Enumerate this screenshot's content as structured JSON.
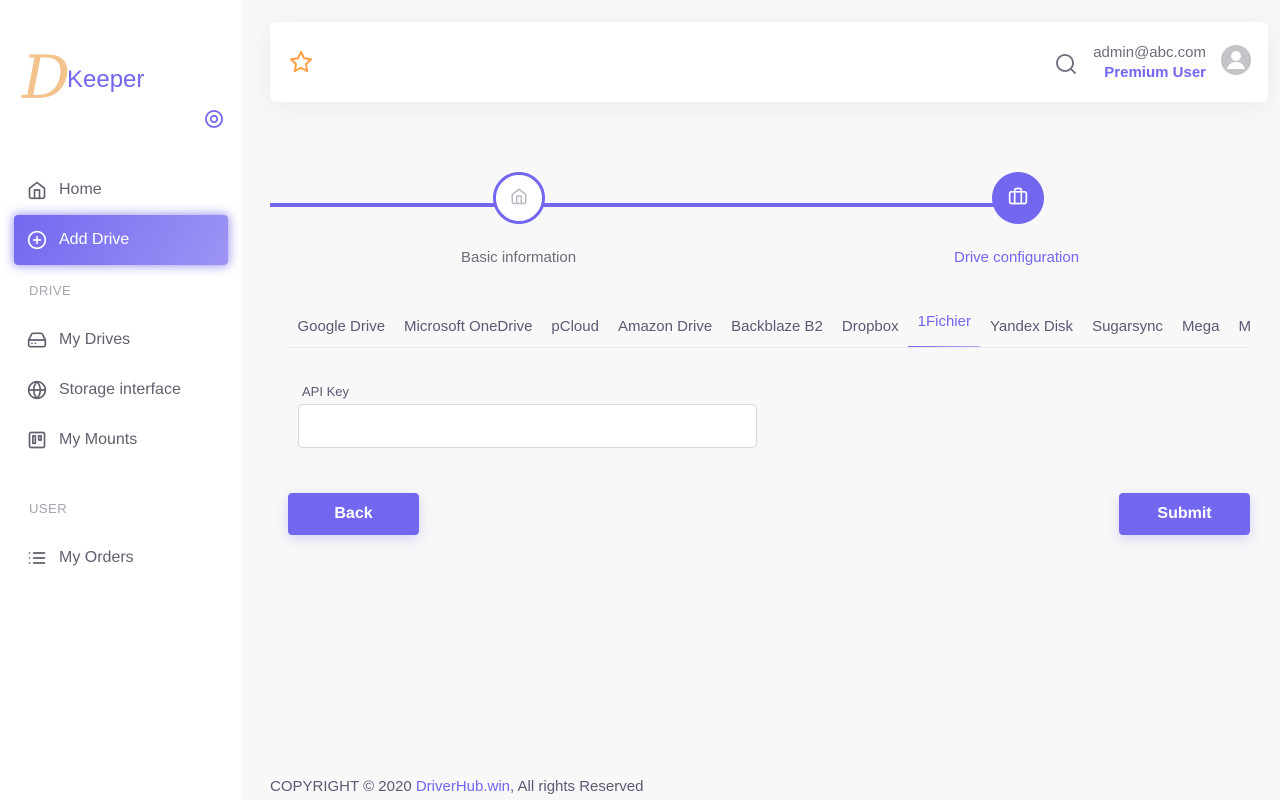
{
  "brand": {
    "logo_letter": "D",
    "name": "Keeper"
  },
  "sidebar": {
    "items": [
      {
        "label": "Home",
        "icon": "home-icon"
      },
      {
        "label": "Add Drive",
        "icon": "plus-circle-icon",
        "active": true
      }
    ],
    "drive_header": "DRIVE",
    "drive_items": [
      {
        "label": "My Drives",
        "icon": "hard-drive-icon"
      },
      {
        "label": "Storage interface",
        "icon": "globe-icon"
      },
      {
        "label": "My Mounts",
        "icon": "trello-icon"
      }
    ],
    "user_header": "USER",
    "user_items": [
      {
        "label": "My Orders",
        "icon": "list-icon"
      }
    ]
  },
  "navbar": {
    "email": "admin@abc.com",
    "role": "Premium User"
  },
  "stepper": {
    "steps": [
      {
        "label": "Basic information",
        "icon": "home-icon"
      },
      {
        "label": "Drive configuration",
        "icon": "briefcase-icon",
        "active": true
      }
    ]
  },
  "tabs": [
    "Google Drive",
    "Microsoft OneDrive",
    "pCloud",
    "Amazon Drive",
    "Backblaze B2",
    "Dropbox",
    "1Fichier",
    "Yandex Disk",
    "Sugarsync",
    "Mega",
    "Mail."
  ],
  "active_tab": "1Fichier",
  "form": {
    "api_key_label": "API Key",
    "api_key_value": ""
  },
  "buttons": {
    "back": "Back",
    "submit": "Submit"
  },
  "footer": {
    "prefix": "COPYRIGHT © 2020 ",
    "link": "DriverHub.win",
    "suffix": ", All rights Reserved"
  },
  "colors": {
    "accent": "#7367f0",
    "logo": "#f2c38c",
    "star": "#ff9f43"
  }
}
